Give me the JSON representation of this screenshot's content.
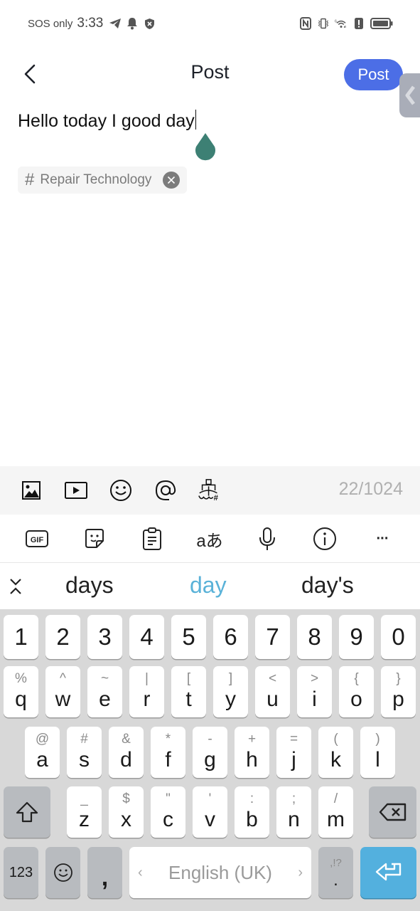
{
  "status_bar": {
    "carrier": "SOS only",
    "time": "3:33",
    "left_icons": [
      "telegram-icon",
      "bell-icon",
      "shield-x-icon"
    ],
    "right_icons": [
      "nfc-icon",
      "vibrate-icon",
      "wifi-6-icon",
      "alert-icon",
      "battery-icon"
    ],
    "wifi_badge": "6"
  },
  "header": {
    "title": "Post",
    "post_button": "Post",
    "accent_color": "#4c6ee6"
  },
  "editor": {
    "text": "Hello today I good day",
    "handle_color": "#3d8074"
  },
  "topic": {
    "hash": "#",
    "label": "Repair Technology"
  },
  "compose_toolbar": {
    "icons": [
      "image-icon",
      "video-icon",
      "emoji-icon",
      "mention-icon",
      "ship-topic-icon"
    ],
    "char_count": "22/1024"
  },
  "keyboard_toolbar": {
    "gif_label": "GIF",
    "translate_label": "aあ",
    "icons": [
      "gif-icon",
      "sticker-icon",
      "clipboard-icon",
      "translate-icon",
      "mic-icon",
      "info-icon",
      "more-icon"
    ],
    "more_label": "···"
  },
  "suggestions": {
    "items": [
      "days",
      "day",
      "day's"
    ],
    "active_index": 1,
    "active_color": "#5ab2d8"
  },
  "keyboard": {
    "number_row": [
      "1",
      "2",
      "3",
      "4",
      "5",
      "6",
      "7",
      "8",
      "9",
      "0"
    ],
    "row1": [
      {
        "main": "q",
        "alt": "%"
      },
      {
        "main": "w",
        "alt": "^"
      },
      {
        "main": "e",
        "alt": "~"
      },
      {
        "main": "r",
        "alt": "|"
      },
      {
        "main": "t",
        "alt": "["
      },
      {
        "main": "y",
        "alt": "]"
      },
      {
        "main": "u",
        "alt": "<"
      },
      {
        "main": "i",
        "alt": ">"
      },
      {
        "main": "o",
        "alt": "{"
      },
      {
        "main": "p",
        "alt": "}"
      }
    ],
    "row2": [
      {
        "main": "a",
        "alt": "@"
      },
      {
        "main": "s",
        "alt": "#"
      },
      {
        "main": "d",
        "alt": "&"
      },
      {
        "main": "f",
        "alt": "*"
      },
      {
        "main": "g",
        "alt": "-"
      },
      {
        "main": "h",
        "alt": "+"
      },
      {
        "main": "j",
        "alt": "="
      },
      {
        "main": "k",
        "alt": "("
      },
      {
        "main": "l",
        "alt": ")"
      }
    ],
    "row3": [
      {
        "main": "z",
        "alt": "_"
      },
      {
        "main": "x",
        "alt": "$"
      },
      {
        "main": "c",
        "alt": "\""
      },
      {
        "main": "v",
        "alt": "'"
      },
      {
        "main": "b",
        "alt": ":"
      },
      {
        "main": "n",
        "alt": ";"
      },
      {
        "main": "m",
        "alt": "/"
      }
    ],
    "numbers_key": "123",
    "comma_key": ",",
    "space_label": "English (UK)",
    "space_left_arrow": "‹",
    "space_right_arrow": "›",
    "period_key": ".",
    "period_alt": ",!?",
    "enter_color": "#53b0de"
  }
}
